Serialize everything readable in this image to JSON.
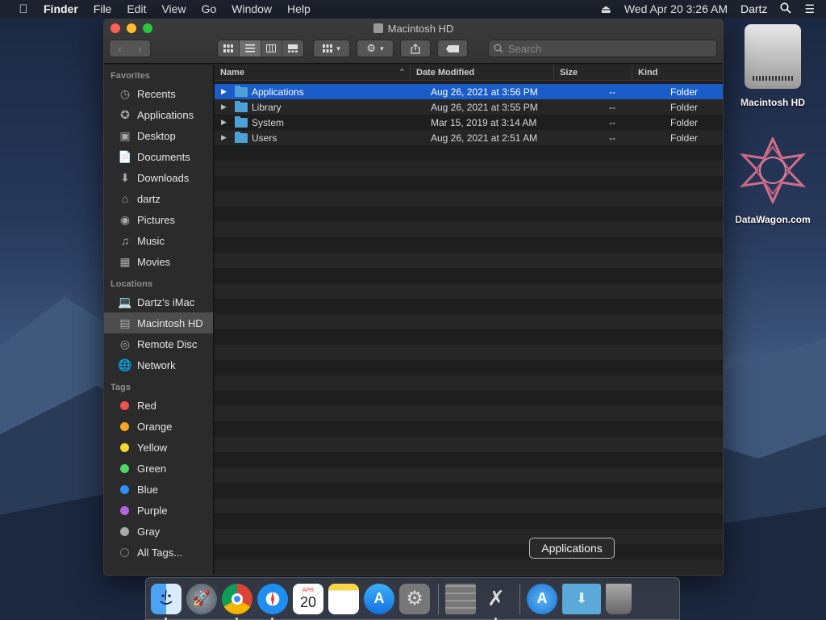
{
  "menubar": {
    "apple_icon": "apple-icon",
    "app_name": "Finder",
    "menus": [
      "File",
      "Edit",
      "View",
      "Go",
      "Window",
      "Help"
    ],
    "datetime": "Wed Apr 20  3:26 AM",
    "user": "Dartz"
  },
  "window": {
    "title": "Macintosh HD",
    "search_placeholder": "Search"
  },
  "sidebar": {
    "favorites_header": "Favorites",
    "favorites": [
      {
        "label": "Recents",
        "icon": "clock-icon"
      },
      {
        "label": "Applications",
        "icon": "applications-icon"
      },
      {
        "label": "Desktop",
        "icon": "desktop-icon"
      },
      {
        "label": "Documents",
        "icon": "document-icon"
      },
      {
        "label": "Downloads",
        "icon": "download-icon"
      },
      {
        "label": "dartz",
        "icon": "home-icon"
      },
      {
        "label": "Pictures",
        "icon": "camera-icon"
      },
      {
        "label": "Music",
        "icon": "music-icon"
      },
      {
        "label": "Movies",
        "icon": "film-icon"
      }
    ],
    "locations_header": "Locations",
    "locations": [
      {
        "label": "Dartz’s iMac",
        "icon": "computer-icon"
      },
      {
        "label": "Macintosh HD",
        "icon": "disk-icon"
      },
      {
        "label": "Remote Disc",
        "icon": "disc-icon"
      },
      {
        "label": "Network",
        "icon": "globe-icon"
      }
    ],
    "tags_header": "Tags",
    "tags": [
      {
        "label": "Red",
        "color": "#f0524f"
      },
      {
        "label": "Orange",
        "color": "#f5a623"
      },
      {
        "label": "Yellow",
        "color": "#f7d82b"
      },
      {
        "label": "Green",
        "color": "#4cd964"
      },
      {
        "label": "Blue",
        "color": "#2e8ef7"
      },
      {
        "label": "Purple",
        "color": "#b463e0"
      },
      {
        "label": "Gray",
        "color": "#a9a9a9"
      },
      {
        "label": "All Tags...",
        "color": "#555555"
      }
    ]
  },
  "columns": {
    "name": "Name",
    "date": "Date Modified",
    "size": "Size",
    "kind": "Kind"
  },
  "files": [
    {
      "name": "Applications",
      "date": "Aug 26, 2021 at 3:56 PM",
      "size": "--",
      "kind": "Folder"
    },
    {
      "name": "Library",
      "date": "Aug 26, 2021 at 3:55 PM",
      "size": "--",
      "kind": "Folder"
    },
    {
      "name": "System",
      "date": "Mar 15, 2019 at 3:14 AM",
      "size": "--",
      "kind": "Folder"
    },
    {
      "name": "Users",
      "date": "Aug 26, 2021 at 2:51 AM",
      "size": "--",
      "kind": "Folder"
    }
  ],
  "desktop": {
    "hd_label": "Macintosh HD",
    "datawagon_label": "DataWagon.com"
  },
  "tooltip": "Applications",
  "dock": {
    "calendar_month": "APR",
    "calendar_day": "20",
    "apps": [
      "finder-icon",
      "launchpad-icon",
      "chrome-icon",
      "safari-icon",
      "calendar-icon",
      "notes-icon",
      "app-store-icon",
      "system-preferences-icon",
      "calculator-icon",
      "utility-icon",
      "applications-folder-icon",
      "downloads-folder-icon",
      "trash-icon"
    ]
  }
}
